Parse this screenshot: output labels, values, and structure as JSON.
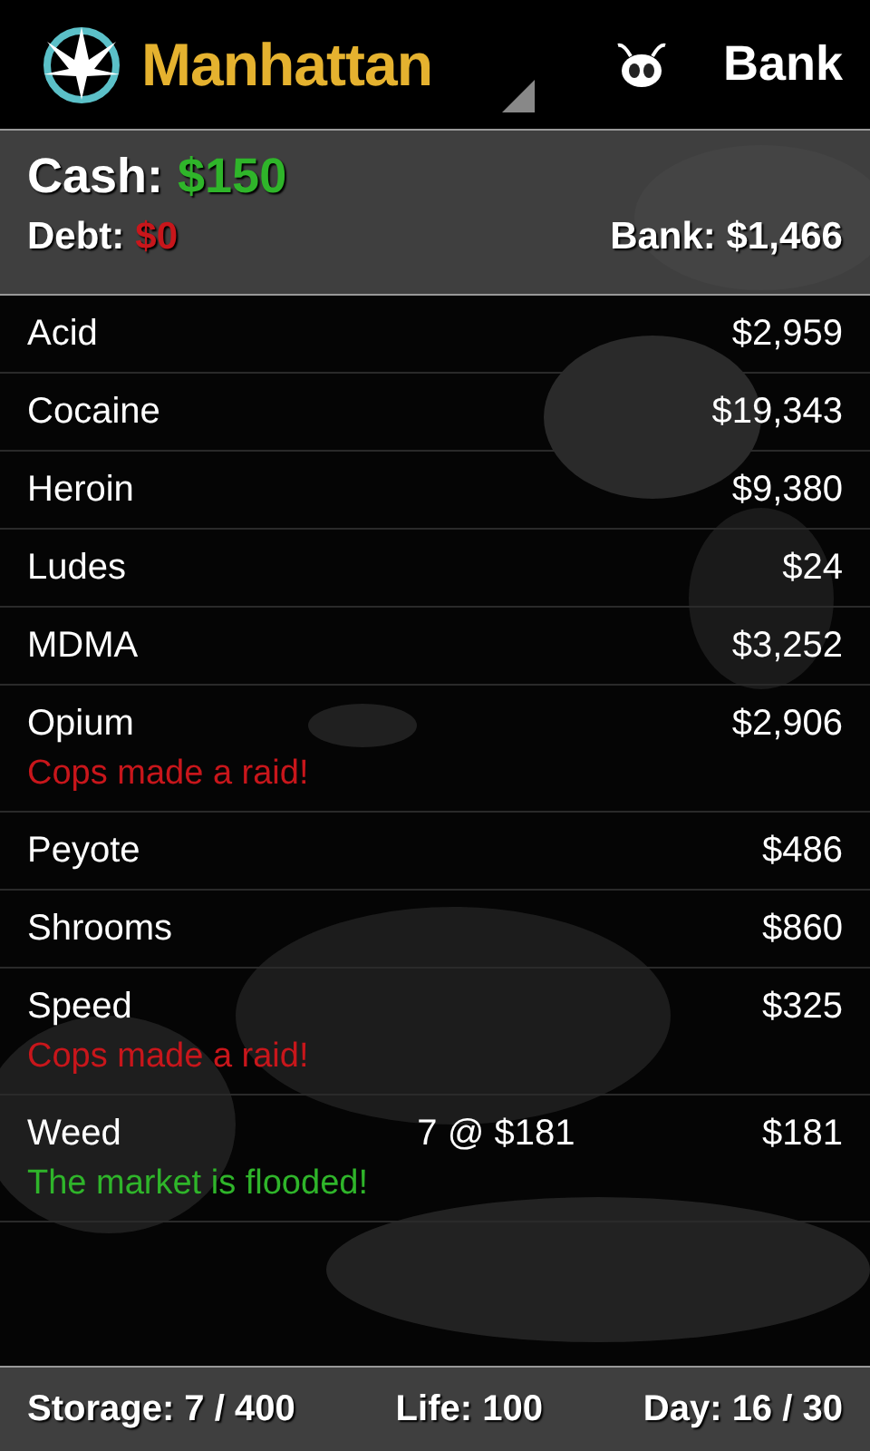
{
  "header": {
    "location": "Manhattan",
    "bank_button": "Bank"
  },
  "summary": {
    "cash_label": "Cash:",
    "cash": "$150",
    "debt_label": "Debt:",
    "debt": "$0",
    "bank": "Bank: $1,466"
  },
  "drugs": [
    {
      "name": "Acid",
      "price": "$2,959"
    },
    {
      "name": "Cocaine",
      "price": "$19,343"
    },
    {
      "name": "Heroin",
      "price": "$9,380"
    },
    {
      "name": "Ludes",
      "price": "$24"
    },
    {
      "name": "MDMA",
      "price": "$3,252"
    },
    {
      "name": "Opium",
      "price": "$2,906",
      "event": {
        "text": "Cops made a raid!",
        "kind": "raid"
      }
    },
    {
      "name": "Peyote",
      "price": "$486"
    },
    {
      "name": "Shrooms",
      "price": "$860"
    },
    {
      "name": "Speed",
      "price": "$325",
      "event": {
        "text": "Cops made a raid!",
        "kind": "raid"
      }
    },
    {
      "name": "Weed",
      "holding": "7 @ $181",
      "price": "$181",
      "event": {
        "text": "The market is flooded!",
        "kind": "flood"
      }
    }
  ],
  "status_bar": {
    "storage": "Storage: 7 / 400",
    "life": "Life: 100",
    "day": "Day: 16 / 30"
  }
}
